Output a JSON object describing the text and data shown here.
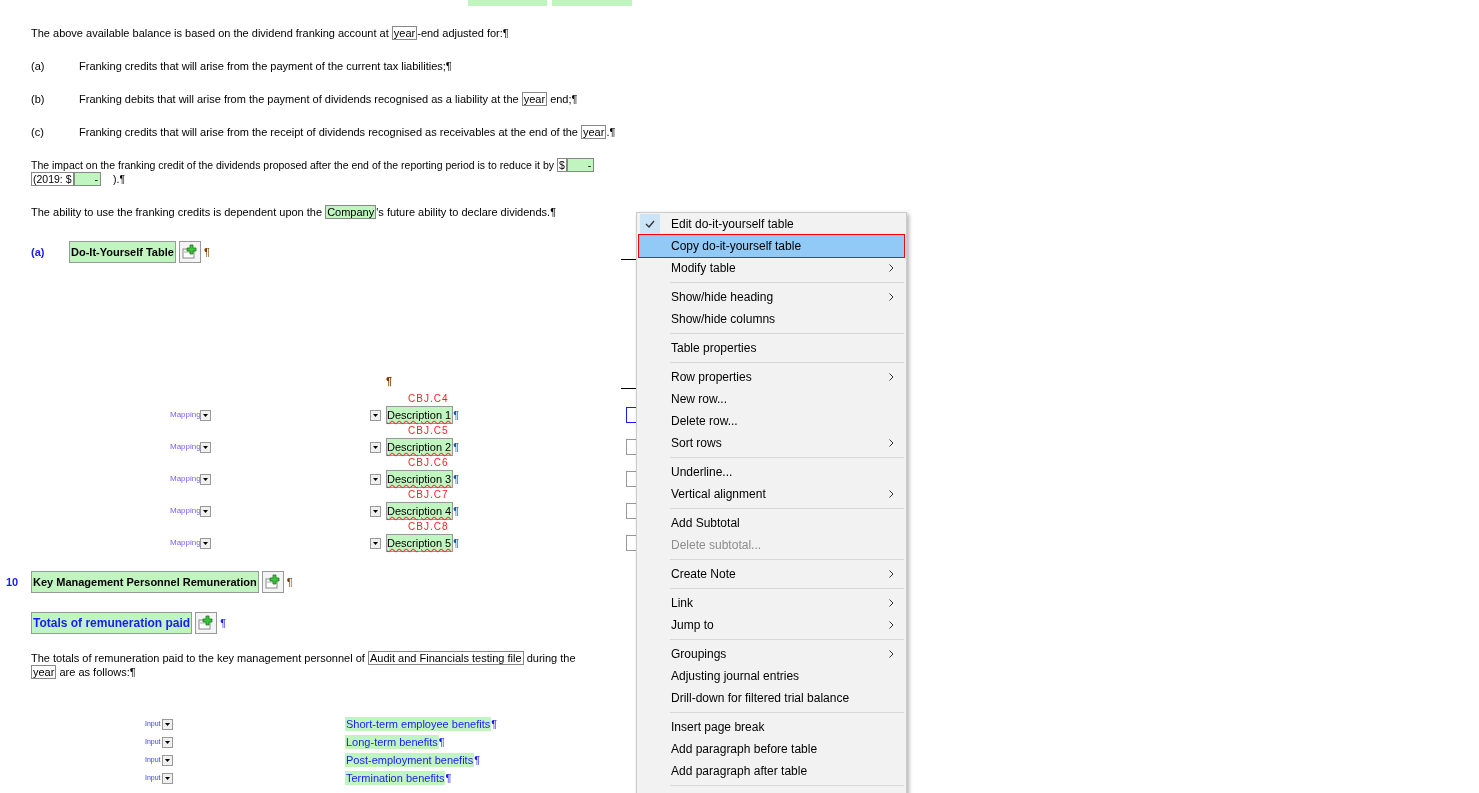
{
  "intro_paragraph": [
    {
      "kind": "plain",
      "text": "The above available balance is based on the dividend franking account at "
    },
    {
      "kind": "field",
      "text": "year"
    },
    {
      "kind": "plain",
      "text": "-end adjusted for:¶"
    }
  ],
  "list_items": [
    {
      "label": "(a)",
      "segments": [
        {
          "kind": "plain",
          "text": "Franking credits that will arise from the payment of the current tax liabilities;¶"
        }
      ]
    },
    {
      "label": "(b)",
      "segments": [
        {
          "kind": "plain",
          "text": "Franking debits that will arise from the payment of dividends recognised as a liability at the "
        },
        {
          "kind": "field",
          "text": "year"
        },
        {
          "kind": "plain",
          "text": " end;¶"
        }
      ]
    },
    {
      "label": "(c)",
      "segments": [
        {
          "kind": "plain",
          "text": "Franking credits that will arise from the receipt of dividends recognised as receivables at the end of the "
        },
        {
          "kind": "field",
          "text": "year"
        },
        {
          "kind": "plain",
          "text": ".¶"
        }
      ]
    }
  ],
  "impact_paragraph": [
    {
      "kind": "plain",
      "text": "The impact on the franking credit of the dividends proposed after the end of the reporting period is to reduce it by "
    },
    {
      "kind": "field",
      "text": "$"
    },
    {
      "kind": "amount",
      "text": "-"
    },
    {
      "kind": "field",
      "text": "(2019: $"
    },
    {
      "kind": "amount",
      "text": "-"
    },
    {
      "kind": "plain",
      "text": ").¶"
    }
  ],
  "ability_paragraph": [
    {
      "kind": "plain",
      "text": "The ability to use the franking credits is dependent upon the "
    },
    {
      "kind": "highlight",
      "text": "Company"
    },
    {
      "kind": "plain",
      "text": "'s future ability to declare dividends.¶"
    }
  ],
  "diy_heading": {
    "label": "(a)",
    "title": "Do-It-Yourself Table",
    "pilcrow": "¶"
  },
  "diy_table": {
    "pilcrow": "¶",
    "rows": [
      {
        "mapping": "Mapping",
        "code": "CBJ.C4",
        "description": "Description 1",
        "pilcrow": "¶",
        "focused": true
      },
      {
        "mapping": "Mapping",
        "code": "CBJ.C5",
        "description": "Description 2",
        "pilcrow": "¶",
        "focused": false
      },
      {
        "mapping": "Mapping",
        "code": "CBJ.C6",
        "description": "Description 3",
        "pilcrow": "¶",
        "focused": false
      },
      {
        "mapping": "Mapping",
        "code": "CBJ.C7",
        "description": "Description 4",
        "pilcrow": "¶",
        "focused": false
      },
      {
        "mapping": "Mapping",
        "code": "CBJ.C8",
        "description": "Description 5",
        "pilcrow": "¶",
        "focused": false
      }
    ]
  },
  "note": {
    "number": "10",
    "title": "Key Management Personnel Remuneration",
    "pilcrow": "¶"
  },
  "subheading": {
    "title": "Totals of remuneration paid",
    "pilcrow": "¶"
  },
  "remuneration_paragraph": [
    {
      "kind": "plain",
      "text": "The totals of remuneration paid to the key management personnel of "
    },
    {
      "kind": "field",
      "text": "Audit and Financials testing file"
    },
    {
      "kind": "plain",
      "text": " during the "
    },
    {
      "kind": "field",
      "text": "year"
    },
    {
      "kind": "plain",
      "text": " are as follows:¶"
    }
  ],
  "remuneration_rows": [
    {
      "input": "Input",
      "label": "Short-term employee benefits",
      "pilcrow": "¶"
    },
    {
      "input": "Input",
      "label": "Long-term benefits",
      "pilcrow": "¶"
    },
    {
      "input": "Input",
      "label": "Post-employment benefits",
      "pilcrow": "¶"
    },
    {
      "input": "Input",
      "label": "Termination benefits",
      "pilcrow": "¶"
    }
  ],
  "context_menu": {
    "groups": [
      [
        {
          "label": "Edit do-it-yourself table",
          "checked": true,
          "selected": false,
          "submenu": false,
          "disabled": false
        },
        {
          "label": "Copy do-it-yourself table",
          "checked": false,
          "selected": true,
          "submenu": false,
          "disabled": false
        },
        {
          "label": "Modify table",
          "checked": false,
          "selected": false,
          "submenu": true,
          "disabled": false
        }
      ],
      [
        {
          "label": "Show/hide heading",
          "checked": false,
          "selected": false,
          "submenu": true,
          "disabled": false
        },
        {
          "label": "Show/hide columns",
          "checked": false,
          "selected": false,
          "submenu": false,
          "disabled": false
        }
      ],
      [
        {
          "label": "Table properties",
          "checked": false,
          "selected": false,
          "submenu": false,
          "disabled": false
        }
      ],
      [
        {
          "label": "Row properties",
          "checked": false,
          "selected": false,
          "submenu": true,
          "disabled": false
        },
        {
          "label": "New row...",
          "checked": false,
          "selected": false,
          "submenu": false,
          "disabled": false
        },
        {
          "label": "Delete row...",
          "checked": false,
          "selected": false,
          "submenu": false,
          "disabled": false
        },
        {
          "label": "Sort rows",
          "checked": false,
          "selected": false,
          "submenu": true,
          "disabled": false
        }
      ],
      [
        {
          "label": "Underline...",
          "checked": false,
          "selected": false,
          "submenu": false,
          "disabled": false
        },
        {
          "label": "Vertical alignment",
          "checked": false,
          "selected": false,
          "submenu": true,
          "disabled": false
        }
      ],
      [
        {
          "label": "Add Subtotal",
          "checked": false,
          "selected": false,
          "submenu": false,
          "disabled": false
        },
        {
          "label": "Delete subtotal...",
          "checked": false,
          "selected": false,
          "submenu": false,
          "disabled": true
        }
      ],
      [
        {
          "label": "Create Note",
          "checked": false,
          "selected": false,
          "submenu": true,
          "disabled": false
        }
      ],
      [
        {
          "label": "Link",
          "checked": false,
          "selected": false,
          "submenu": true,
          "disabled": false
        },
        {
          "label": "Jump to",
          "checked": false,
          "selected": false,
          "submenu": true,
          "disabled": false
        }
      ],
      [
        {
          "label": "Groupings",
          "checked": false,
          "selected": false,
          "submenu": true,
          "disabled": false
        },
        {
          "label": "Adjusting journal entries",
          "checked": false,
          "selected": false,
          "submenu": false,
          "disabled": false
        },
        {
          "label": "Drill-down for filtered trial balance",
          "checked": false,
          "selected": false,
          "submenu": false,
          "disabled": false
        }
      ],
      [
        {
          "label": "Insert page break",
          "checked": false,
          "selected": false,
          "submenu": false,
          "disabled": false
        },
        {
          "label": "Add paragraph before table",
          "checked": false,
          "selected": false,
          "submenu": false,
          "disabled": false
        },
        {
          "label": "Add paragraph after table",
          "checked": false,
          "selected": false,
          "submenu": false,
          "disabled": false
        }
      ]
    ]
  }
}
